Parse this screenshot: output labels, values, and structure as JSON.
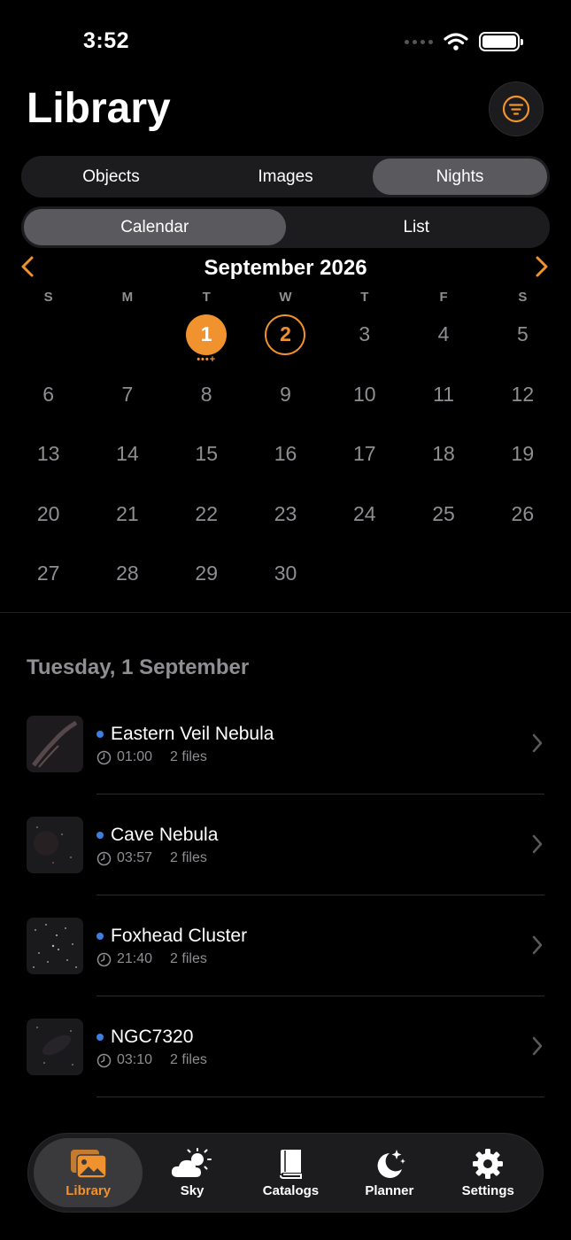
{
  "status": {
    "time": "3:52"
  },
  "header": {
    "title": "Library"
  },
  "segments": {
    "main": [
      "Objects",
      "Images",
      "Nights"
    ],
    "main_active": "Nights",
    "sub": [
      "Calendar",
      "List"
    ],
    "sub_active": "Calendar"
  },
  "calendar": {
    "month": "September 2026",
    "weekdays": [
      "S",
      "M",
      "T",
      "W",
      "T",
      "F",
      "S"
    ],
    "leading_blanks": 2,
    "days": [
      "1",
      "2",
      "3",
      "4",
      "5",
      "6",
      "7",
      "8",
      "9",
      "10",
      "11",
      "12",
      "13",
      "14",
      "15",
      "16",
      "17",
      "18",
      "19",
      "20",
      "21",
      "22",
      "23",
      "24",
      "25",
      "26",
      "27",
      "28",
      "29",
      "30"
    ],
    "selected_day": "1",
    "selected_marker": "•••+",
    "ringed_day": "2"
  },
  "section": {
    "title": "Tuesday, 1 September"
  },
  "nights": [
    {
      "name": "Eastern Veil Nebula",
      "time": "01:00",
      "files": "2 files"
    },
    {
      "name": "Cave Nebula",
      "time": "03:57",
      "files": "2 files"
    },
    {
      "name": "Foxhead Cluster",
      "time": "21:40",
      "files": "2 files"
    },
    {
      "name": "NGC7320",
      "time": "03:10",
      "files": "2 files"
    }
  ],
  "tabbar": {
    "items": [
      {
        "label": "Library",
        "icon": "photos-icon",
        "active": true
      },
      {
        "label": "Sky",
        "icon": "cloud-sun-icon",
        "active": false
      },
      {
        "label": "Catalogs",
        "icon": "book-icon",
        "active": false
      },
      {
        "label": "Planner",
        "icon": "moon-stars-icon",
        "active": false
      },
      {
        "label": "Settings",
        "icon": "gear-icon",
        "active": false
      }
    ]
  },
  "colors": {
    "accent": "#f0922e",
    "dot_blue": "#3d7fe0",
    "secondary_text": "#8e8e93"
  }
}
